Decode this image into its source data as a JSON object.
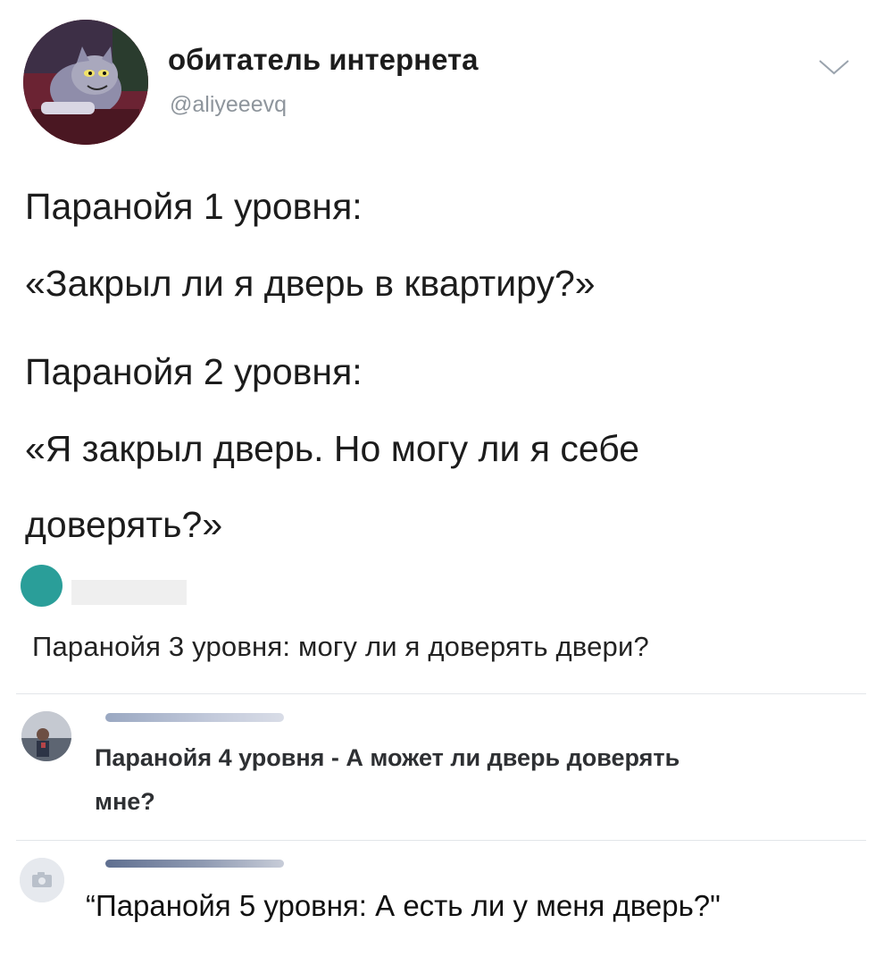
{
  "tweet": {
    "author_name": "обитатель интернета",
    "author_handle": "@aliyeeevq",
    "text_lines": [
      "Паранойя 1 уровня:",
      "«Закрыл ли я дверь в квартиру?»",
      "Паранойя 2 уровня:",
      "«Я закрыл дверь. Но могу ли я себе",
      "доверять?»"
    ]
  },
  "replies": [
    {
      "text": "Паранойя 3 уровня: могу ли я доверять двери?"
    },
    {
      "text_lines": [
        "Паранойя 4 уровня - А может ли дверь доверять",
        "мне?"
      ]
    },
    {
      "text": "“Паранойя 5 уровня: А есть ли у меня дверь?\""
    }
  ],
  "icons": {
    "menu": "chevron-down-icon",
    "placeholder_avatar": "camera-icon"
  },
  "colors": {
    "reply_avatar_teal": "#2a9e99",
    "handle_gray": "#8e959c"
  }
}
